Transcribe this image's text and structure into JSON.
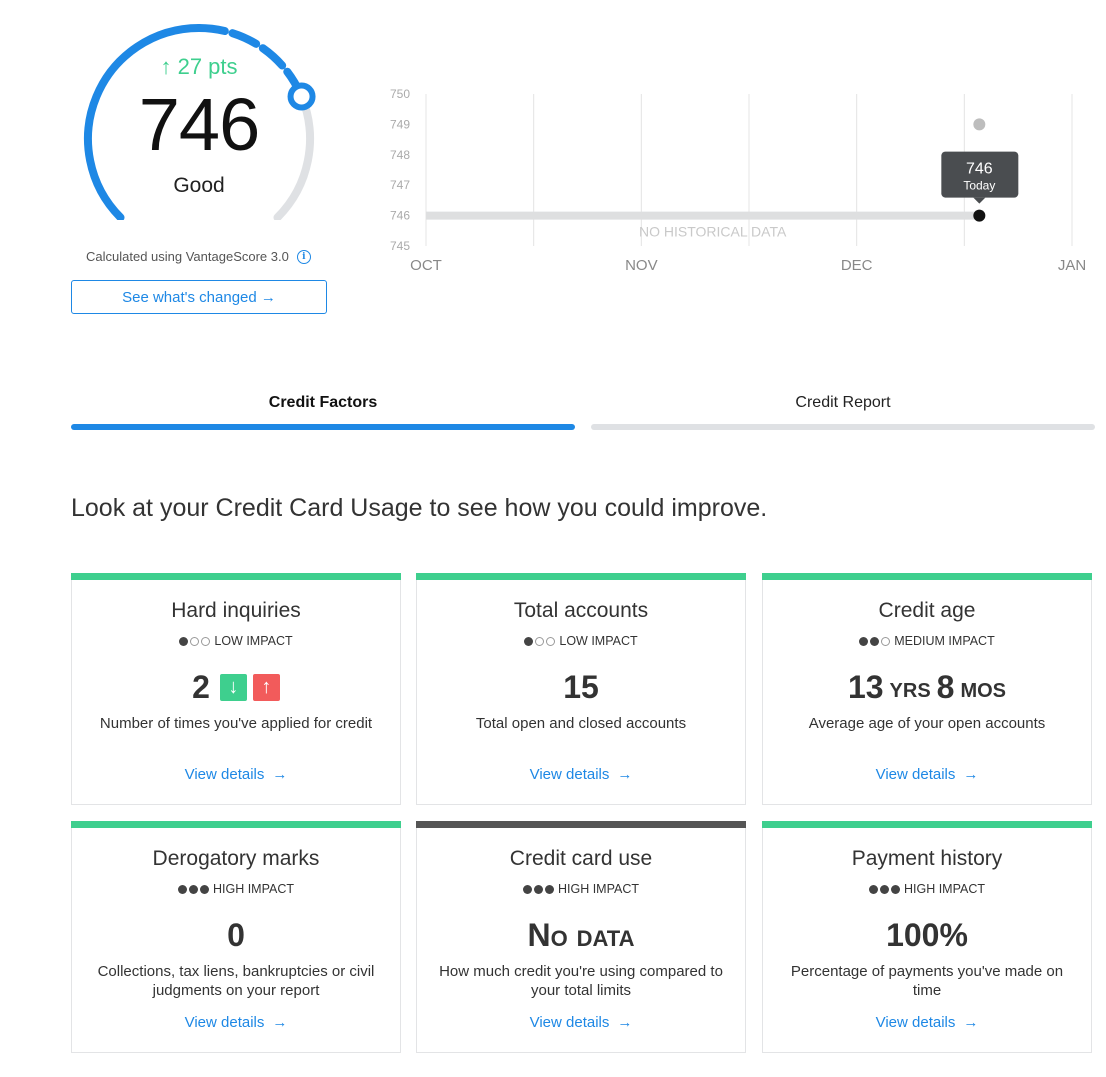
{
  "score": {
    "value": "746",
    "change": "↑ 27 pts",
    "rating": "Good",
    "gauge_fraction": 0.75,
    "calculated_using": "Calculated using VantageScore 3.0",
    "info_icon": "i",
    "see_changed": "See what's changed →"
  },
  "chart_data": {
    "type": "line",
    "title": "",
    "xlabel": "",
    "ylabel": "",
    "x_ticks": [
      "OCT",
      "NOV",
      "DEC",
      "JAN"
    ],
    "y_ticks": [
      "745",
      "746",
      "747",
      "748",
      "749",
      "750"
    ],
    "ylim": [
      745,
      750
    ],
    "series": [
      {
        "x": [
          "DEC (late)"
        ],
        "values": [
          746
        ]
      }
    ],
    "previous_point": 749,
    "tooltip": {
      "value": "746",
      "label": "Today"
    },
    "annotation": "NO HISTORICAL DATA",
    "grid": true
  },
  "tabs": [
    {
      "label": "Credit Factors",
      "active": true
    },
    {
      "label": "Credit Report",
      "active": false
    }
  ],
  "headline": "Look at your Credit Card Usage to see how you could improve.",
  "colors": {
    "accent": "#1e88e5",
    "good": "#3ecf8e",
    "bad": "#f25b5b",
    "neutral_bar": "#555555"
  },
  "cards": [
    {
      "title": "Hard inquiries",
      "impact_level": 1,
      "impact": "LOW IMPACT",
      "value": "2",
      "arrows": true,
      "arrow_down": "↓",
      "arrow_up": "↑",
      "description": "Number of times you've applied for credit",
      "link": "View details",
      "link_arrow": "→",
      "bar_color": "#3ecf8e"
    },
    {
      "title": "Total accounts",
      "impact_level": 1,
      "impact": "LOW IMPACT",
      "value": "15",
      "description": "Total open and closed accounts",
      "link": "View details",
      "link_arrow": "→",
      "bar_color": "#3ecf8e"
    },
    {
      "title": "Credit age",
      "impact_level": 2,
      "impact": "MEDIUM IMPACT",
      "value_parts": [
        "13",
        "yrs",
        "8",
        "mos"
      ],
      "description": "Average age of your open accounts",
      "link": "View details",
      "link_arrow": "→",
      "bar_color": "#3ecf8e"
    },
    {
      "title": "Derogatory marks",
      "impact_level": 3,
      "impact": "HIGH IMPACT",
      "value": "0",
      "description": "Collections, tax liens, bankruptcies or civil judgments on your report",
      "link": "View details",
      "link_arrow": "→",
      "bar_color": "#3ecf8e"
    },
    {
      "title": "Credit card use",
      "impact_level": 3,
      "impact": "HIGH IMPACT",
      "value": "No data",
      "description": "How much credit you're using compared to your total limits",
      "link": "View details",
      "link_arrow": "→",
      "bar_color": "#555555"
    },
    {
      "title": "Payment history",
      "impact_level": 3,
      "impact": "HIGH IMPACT",
      "value": "100%",
      "description": "Percentage of payments you've made on time",
      "link": "View details",
      "link_arrow": "→",
      "bar_color": "#3ecf8e"
    }
  ]
}
